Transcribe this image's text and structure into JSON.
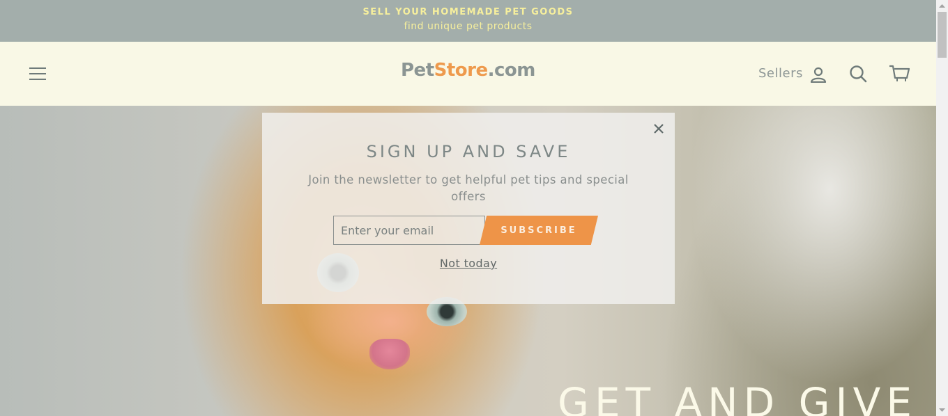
{
  "announcement": {
    "line1": "SELL YOUR HOMEMADE PET GOODS",
    "line2": "find unique pet products"
  },
  "header": {
    "logo": {
      "part1": "Pet",
      "part2": "Store",
      "part3": ".com"
    },
    "sellers_label": "Sellers",
    "icons": [
      "hamburger-menu-icon",
      "user-icon",
      "search-icon",
      "cart-icon"
    ]
  },
  "hero": {
    "title": "GET AND GIVE"
  },
  "modal": {
    "title": "SIGN UP AND SAVE",
    "subtitle": "Join the newsletter to get helpful pet tips and special offers",
    "email_placeholder": "Enter your email",
    "subscribe_label": "SUBSCRIBE",
    "dismiss_label": "Not today",
    "close_icon": "close-icon"
  },
  "colors": {
    "announcement_bg": "#a3aeab",
    "announcement_text": "#f6ef9d",
    "header_bg": "#f9f8e6",
    "accent": "#ee9448",
    "logo_gray": "#8b9593"
  }
}
